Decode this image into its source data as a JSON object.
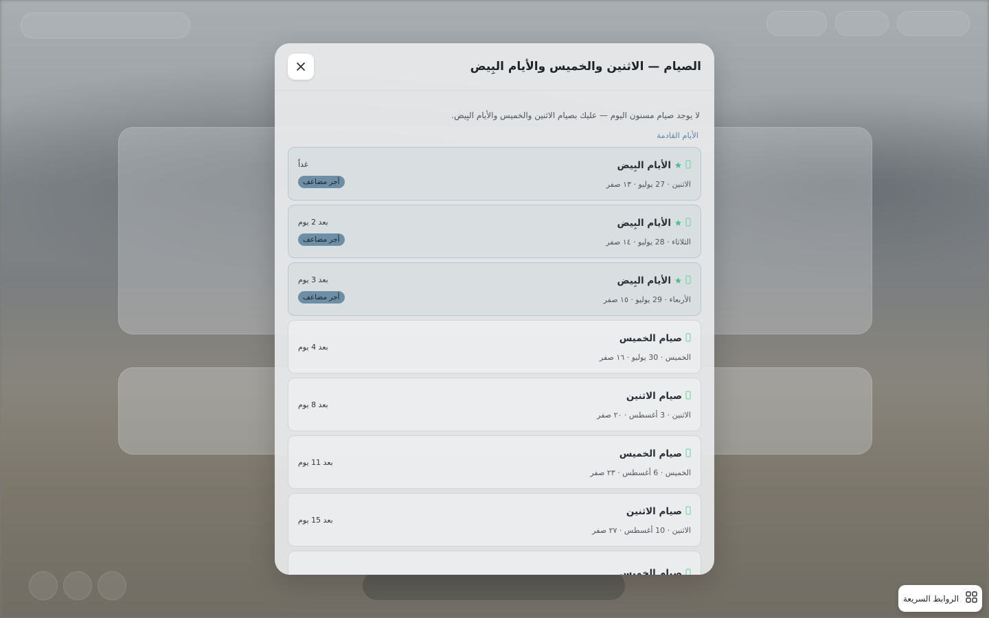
{
  "modal": {
    "title": "الصيام — الاثنين والخميس والأيام البِيض",
    "notice": "لا يوجد صيام مسنون اليوم — عليك بصيام الاثنين والخميس والأيام البِيض.",
    "section_label": "الأيام القادمة"
  },
  "days": [
    {
      "name": "الأيام البِيض",
      "date": "الاثنين · 27 يوليو · ١٣ صفر",
      "relative": "غداً",
      "badge": "أجر مضاعف",
      "white": true
    },
    {
      "name": "الأيام البِيض",
      "date": "الثلاثاء · 28 يوليو · ١٤ صفر",
      "relative": "بعد 2 يوم",
      "badge": "أجر مضاعف",
      "white": true
    },
    {
      "name": "الأيام البِيض",
      "date": "الأربعاء · 29 يوليو · ١٥ صفر",
      "relative": "بعد 3 يوم",
      "badge": "أجر مضاعف",
      "white": true
    },
    {
      "name": "صيام الخميس",
      "date": "الخميس · 30 يوليو · ١٦ صفر",
      "relative": "بعد 4 يوم",
      "white": false
    },
    {
      "name": "صيام الاثنين",
      "date": "الاثنين · 3 أغسطس · ٢٠ صفر",
      "relative": "بعد 8 يوم",
      "white": false
    },
    {
      "name": "صيام الخميس",
      "date": "الخميس · 6 أغسطس · ٢٣ صفر",
      "relative": "بعد 11 يوم",
      "white": false
    },
    {
      "name": "صيام الاثنين",
      "date": "الاثنين · 10 أغسطس · ٢٧ صفر",
      "relative": "بعد 15 يوم",
      "white": false
    },
    {
      "name": "صيام الخميس",
      "date": "",
      "relative": "",
      "white": false
    }
  ],
  "quick_links": {
    "label": "الروابط السريعة"
  },
  "icons": {
    "close": "close-icon",
    "fasting": "fasting-icon",
    "star": "star-icon",
    "grid": "grid-icon"
  },
  "colors": {
    "star": "#4fc08d",
    "fasting_icon": "#7fd8a8",
    "badge_bg": "#6d8ea4",
    "section_label": "#5b87a3"
  }
}
